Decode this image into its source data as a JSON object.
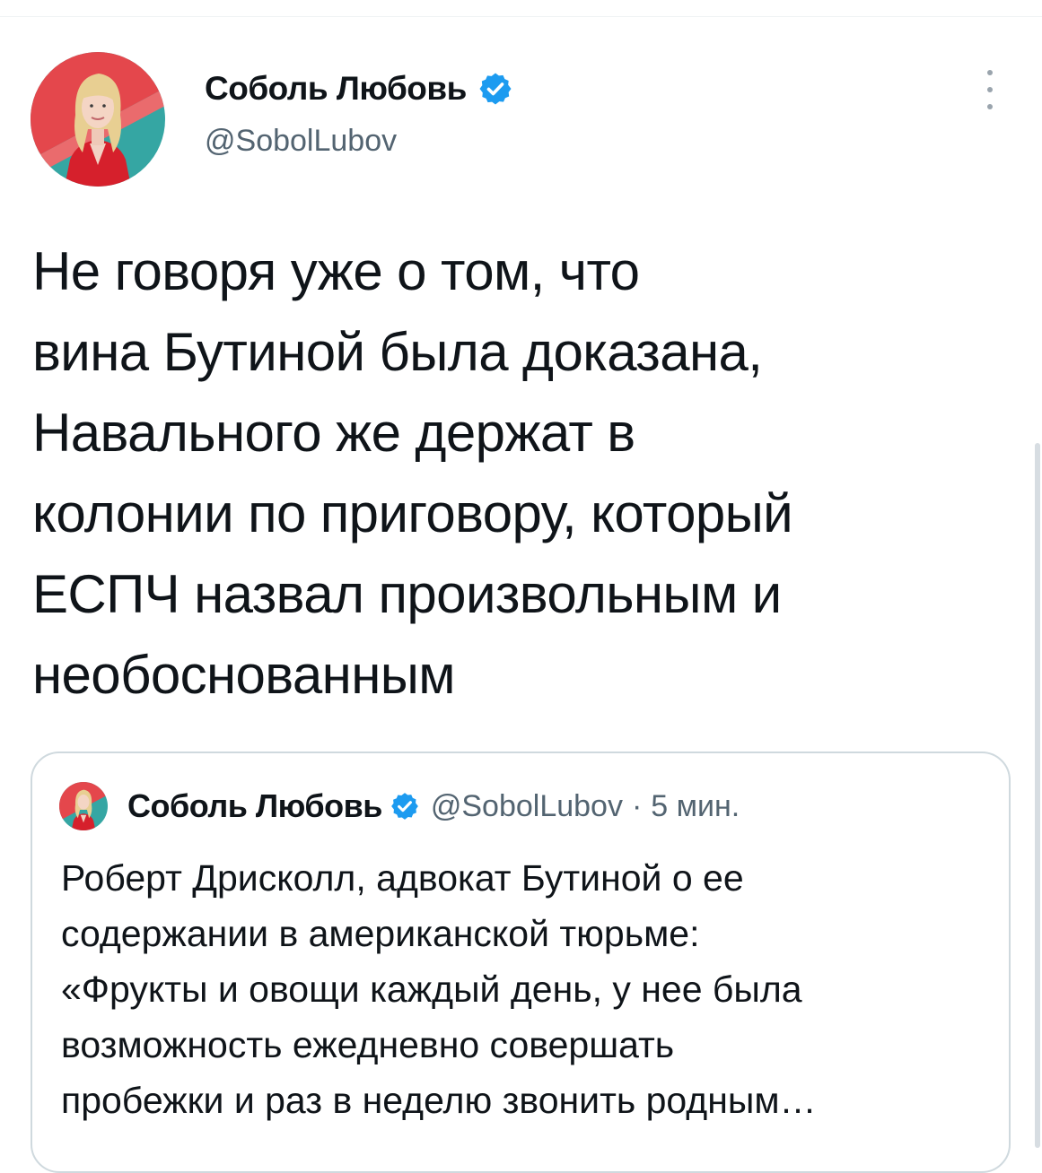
{
  "tweet": {
    "author": {
      "display_name": "Соболь Любовь",
      "handle": "@SobolLubov",
      "verified_icon": "verified-badge-icon"
    },
    "more_icon": "more-vertical-icon",
    "text": "Не говоря уже о том, что\nвина Бутиной была доказана,\nНавального же держат в\nколонии по приговору, который\nЕСПЧ назвал произвольным и\nнеобоснованным"
  },
  "quoted_tweet": {
    "author": {
      "display_name": "Соболь Любовь",
      "handle": "@SobolLubov",
      "verified_icon": "verified-badge-icon"
    },
    "separator": "·",
    "time": "5 мин.",
    "text": "Роберт Дрисколл, адвокат Бутиной о ее\nсодержании в американской тюрьме:\n«Фрукты и овощи каждый день, у нее была\nвозможность ежедневно совершать\nпробежки и раз в неделю звонить родным…"
  },
  "colors": {
    "text_primary": "#0f1419",
    "text_secondary": "#536471",
    "verified_blue": "#1d9bf0",
    "avatar_bg_red": "#e4474c",
    "avatar_bg_teal": "#35a6a3",
    "jacket_red": "#d6202c",
    "border": "#cfd9de"
  }
}
